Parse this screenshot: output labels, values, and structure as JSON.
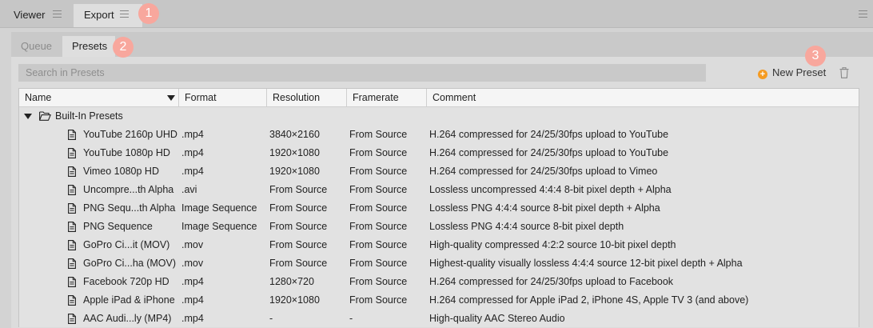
{
  "top_tabs": {
    "viewer": "Viewer",
    "export": "Export"
  },
  "sub_tabs": {
    "queue": "Queue",
    "presets": "Presets"
  },
  "badges": [
    "1",
    "2",
    "3"
  ],
  "search": {
    "placeholder": "Search in Presets",
    "value": ""
  },
  "toolbar": {
    "new_preset": "New Preset"
  },
  "columns": [
    "Name",
    "Format",
    "Resolution",
    "Framerate",
    "Comment"
  ],
  "group": {
    "label": "Built-In Presets"
  },
  "rows": [
    {
      "name": "YouTube 2160p UHD",
      "format": ".mp4",
      "resolution": "3840×2160",
      "framerate": "From Source",
      "comment": "H.264 compressed for 24/25/30fps upload to YouTube"
    },
    {
      "name": "YouTube 1080p HD",
      "format": ".mp4",
      "resolution": "1920×1080",
      "framerate": "From Source",
      "comment": "H.264 compressed for 24/25/30fps upload to YouTube"
    },
    {
      "name": "Vimeo 1080p HD",
      "format": ".mp4",
      "resolution": "1920×1080",
      "framerate": "From Source",
      "comment": "H.264 compressed for 24/25/30fps upload to Vimeo"
    },
    {
      "name": "Uncompre...th Alpha",
      "format": ".avi",
      "resolution": "From Source",
      "framerate": "From Source",
      "comment": "Lossless uncompressed 4:4:4 8-bit pixel depth + Alpha"
    },
    {
      "name": "PNG Sequ...th Alpha",
      "format": "Image Sequence",
      "resolution": "From Source",
      "framerate": "From Source",
      "comment": "Lossless PNG 4:4:4 source 8-bit pixel depth + Alpha"
    },
    {
      "name": "PNG Sequence",
      "format": "Image Sequence",
      "resolution": "From Source",
      "framerate": "From Source",
      "comment": "Lossless PNG 4:4:4 source 8-bit pixel depth"
    },
    {
      "name": "GoPro Ci...it (MOV)",
      "format": ".mov",
      "resolution": "From Source",
      "framerate": "From Source",
      "comment": "High-quality compressed 4:2:2 source 10-bit pixel depth"
    },
    {
      "name": "GoPro Ci...ha (MOV)",
      "format": ".mov",
      "resolution": "From Source",
      "framerate": "From Source",
      "comment": "Highest-quality visually lossless 4:4:4 source 12-bit pixel depth + Alpha"
    },
    {
      "name": "Facebook 720p HD",
      "format": ".mp4",
      "resolution": "1280×720",
      "framerate": "From Source",
      "comment": "H.264 compressed for 24/25/30fps upload to Facebook"
    },
    {
      "name": "Apple iPad & iPhone",
      "format": ".mp4",
      "resolution": "1920×1080",
      "framerate": "From Source",
      "comment": "H.264 compressed for Apple iPad 2, iPhone 4S, Apple TV 3 (and above)"
    },
    {
      "name": "AAC Audi...ly (MP4)",
      "format": ".mp4",
      "resolution": "-",
      "framerate": "-",
      "comment": "High-quality AAC Stereo Audio"
    }
  ]
}
